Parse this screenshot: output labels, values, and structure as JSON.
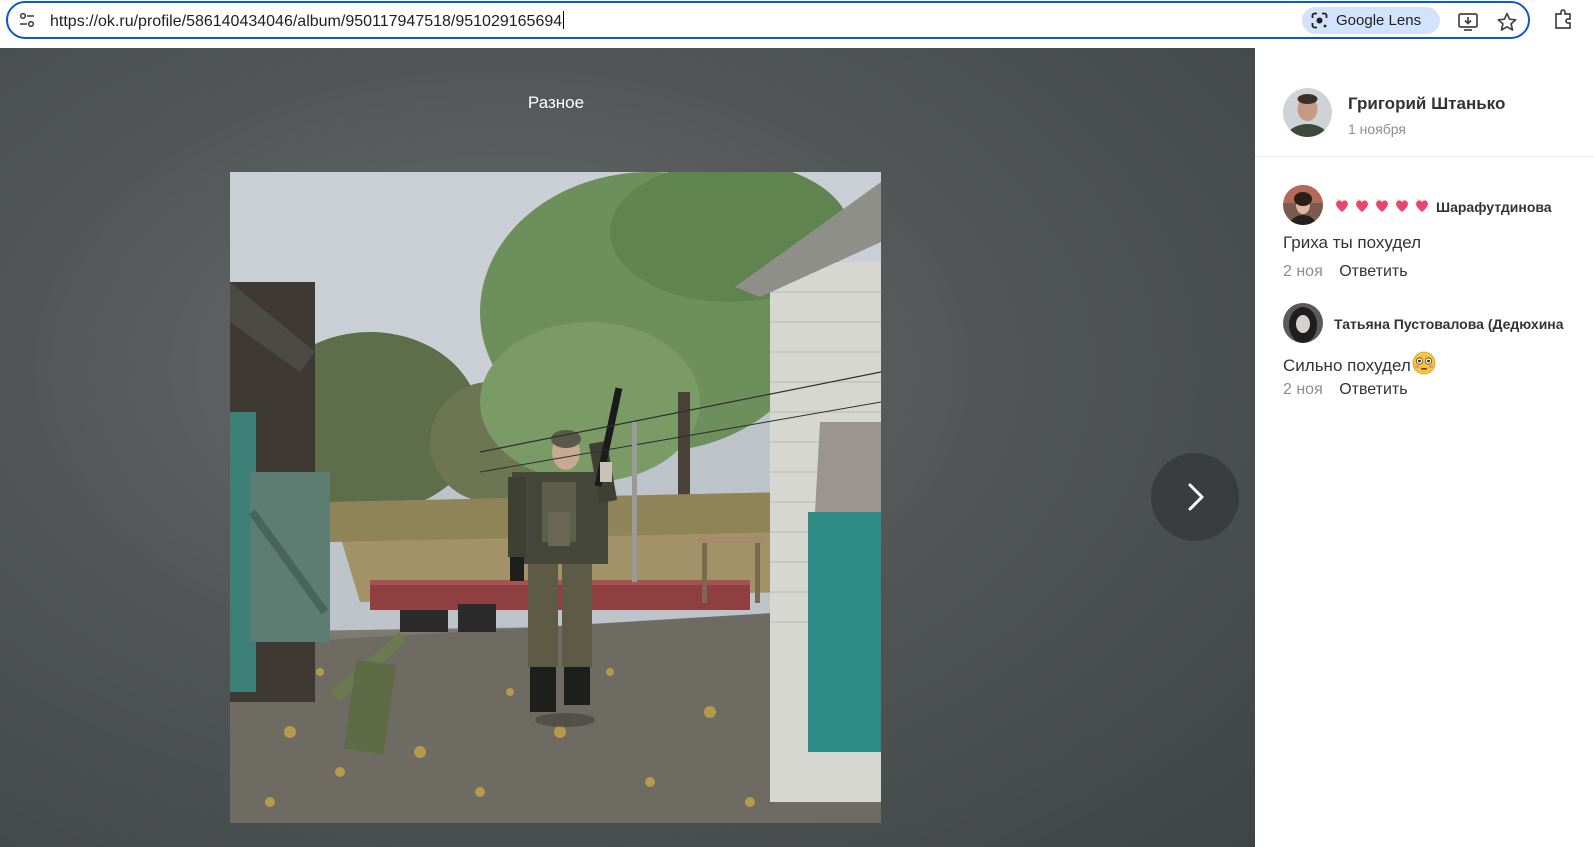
{
  "browser": {
    "url": "https://ok.ru/profile/586140434046/album/950117947518/951029165694",
    "lens_label": "Google Lens"
  },
  "viewer": {
    "album_title": "Разное"
  },
  "post": {
    "author_name": "Григорий Штанько",
    "date": "1 ноября"
  },
  "comments": [
    {
      "author": "Шарафутдинова",
      "author_prefix_icons": "sparkling-heart-emoji x5",
      "text": "Гриха ты похудел",
      "date": "2 ноя",
      "reply_label": "Ответить"
    },
    {
      "author": "Татьяна Пустовалова (Дедюхина",
      "text": "Сильно похудел",
      "text_suffix_icon": "flushed-face-emoji",
      "date": "2 ноя",
      "reply_label": "Ответить"
    }
  ],
  "colors": {
    "focus_ring": "#0b57d0",
    "lens_chip": "#d3e3fd",
    "viewer_bg": "#525656",
    "secondary_text": "#8d8d8d"
  }
}
